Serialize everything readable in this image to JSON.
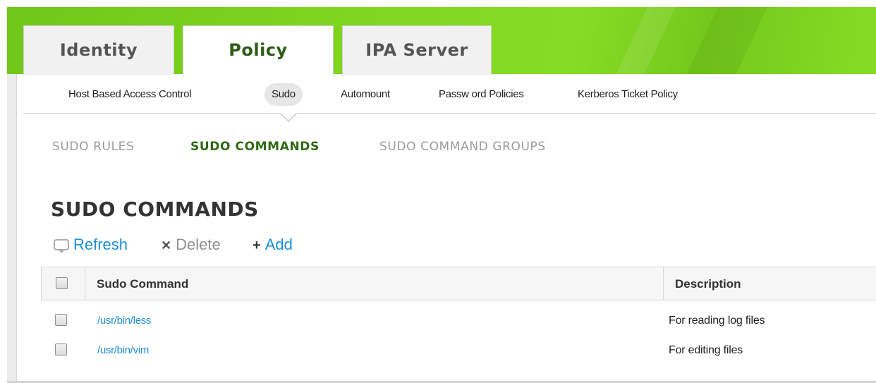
{
  "top_tabs": [
    {
      "label": "Identity",
      "active": false
    },
    {
      "label": "Policy",
      "active": true
    },
    {
      "label": "IPA Server",
      "active": false
    }
  ],
  "subnav": [
    {
      "label": "Host Based Access Control",
      "active": false
    },
    {
      "label": "Sudo",
      "active": true
    },
    {
      "label": "Automount",
      "active": false
    },
    {
      "label": "Passw ord Policies",
      "active": false
    },
    {
      "label": "Kerberos Ticket Policy",
      "active": false
    }
  ],
  "thirdnav": [
    {
      "label": "SUDO RULES",
      "active": false
    },
    {
      "label": "SUDO COMMANDS",
      "active": true
    },
    {
      "label": "SUDO COMMAND GROUPS",
      "active": false
    }
  ],
  "page_title": "SUDO COMMANDS",
  "actions": {
    "refresh": "Refresh",
    "delete": "Delete",
    "add": "Add"
  },
  "table": {
    "columns": [
      "Sudo Command",
      "Description"
    ],
    "rows": [
      {
        "command": "/usr/bin/less",
        "description": "For reading log files"
      },
      {
        "command": "/usr/bin/vim",
        "description": "For editing files"
      }
    ]
  },
  "colors": {
    "brand_green": "#7fd61f",
    "active_text_green": "#2d6a12",
    "link_blue": "#1e8fd6"
  },
  "icons": {
    "refresh": "refresh-icon",
    "delete": "close-icon",
    "add": "plus-icon"
  }
}
